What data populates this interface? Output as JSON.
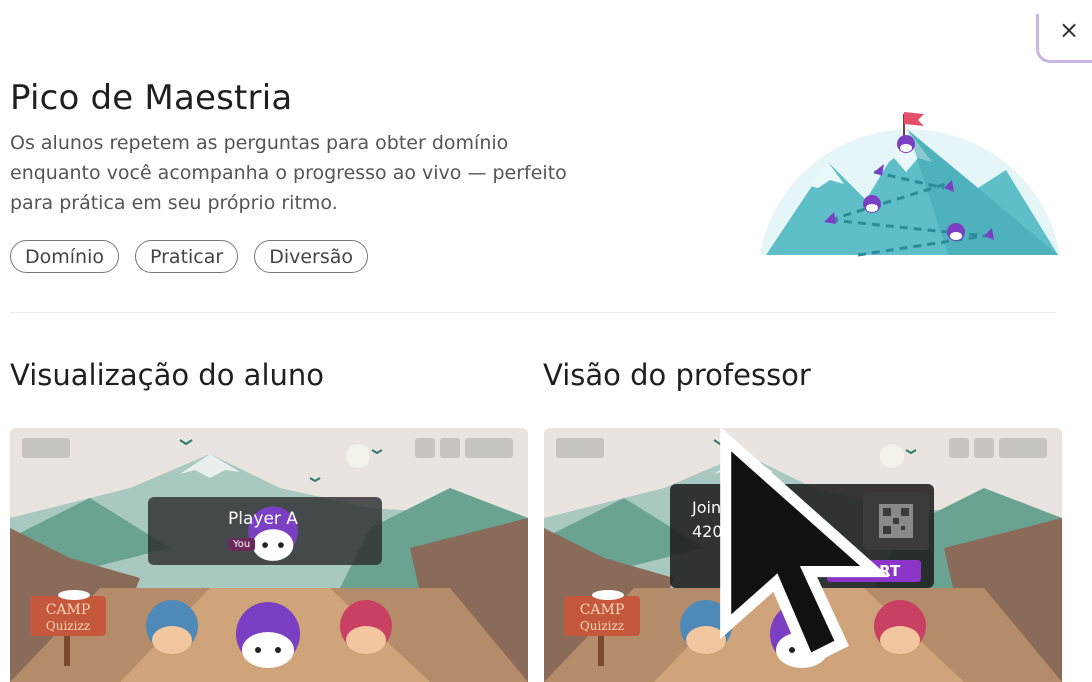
{
  "modal": {
    "close_label": "×",
    "title": "Pico de Maestria",
    "description": "Os alunos repetem as perguntas para obter domínio enquanto você acompanha o progresso ao vivo — perfeito para prática em seu próprio ritmo.",
    "tags": [
      "Domínio",
      "Praticar",
      "Diversão"
    ]
  },
  "student_view": {
    "heading": "Visualização do aluno",
    "player_name": "Player A",
    "player_badge": "You",
    "camp_sign_line1": "CAMP",
    "camp_sign_line2": "Quizizz"
  },
  "teacher_view": {
    "heading": "Visão do professor",
    "join_label": "Join my Quiz",
    "join_code": "420042",
    "start_label": "START",
    "camp_sign_line1": "CAMP",
    "camp_sign_line2": "Quizizz"
  },
  "colors": {
    "accent_purple": "#8b35c9",
    "close_border": "#c9b6e4",
    "mountain_teal": "#5fbfc8",
    "helmet_purple": "#7b3fc4",
    "helmet_blue": "#4f89b8",
    "helmet_red": "#c94063"
  },
  "icons": {
    "close": "close-icon",
    "cursor": "mouse-pointer-icon"
  }
}
